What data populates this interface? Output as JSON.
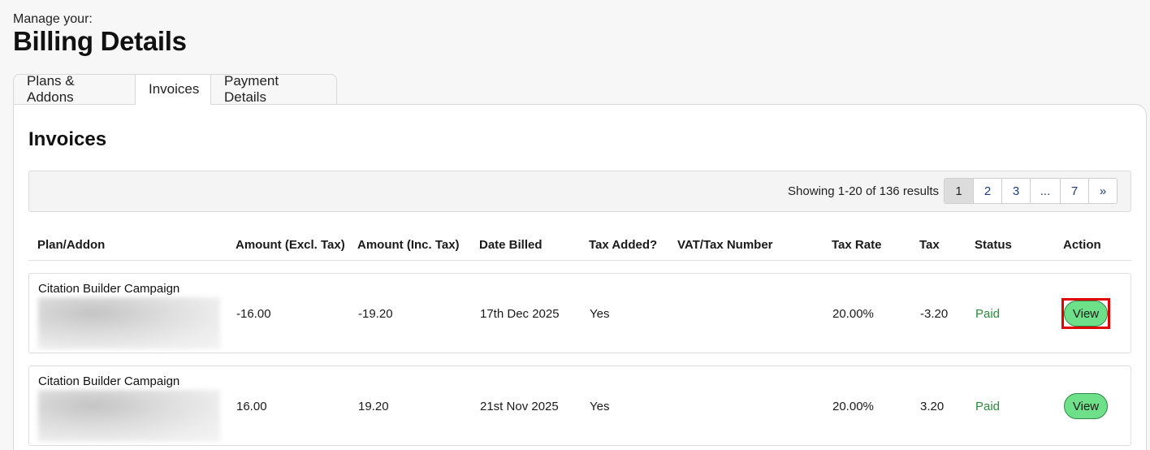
{
  "header": {
    "eyebrow": "Manage your:",
    "title": "Billing Details"
  },
  "tabs": [
    {
      "label": "Plans & Addons",
      "active": false
    },
    {
      "label": "Invoices",
      "active": true
    },
    {
      "label": "Payment Details",
      "active": false
    }
  ],
  "panel": {
    "title": "Invoices",
    "results_text": "Showing 1-20 of 136 results",
    "pagination": [
      "1",
      "2",
      "3",
      "...",
      "7",
      "»"
    ],
    "current_page": "1"
  },
  "table": {
    "headers": [
      "Plan/Addon",
      "Amount (Excl. Tax)",
      "Amount (Inc. Tax)",
      "Date Billed",
      "Tax Added?",
      "VAT/Tax Number",
      "Tax Rate",
      "Tax",
      "Status",
      "Action"
    ],
    "rows": [
      {
        "plan": "Citation Builder Campaign",
        "amount_excl": "-16.00",
        "amount_inc": "-19.20",
        "date": "17th Dec 2025",
        "tax_added": "Yes",
        "vat_number": "",
        "tax_rate": "20.00%",
        "tax": "-3.20",
        "status": "Paid",
        "action": "View",
        "highlighted": true
      },
      {
        "plan": "Citation Builder Campaign",
        "amount_excl": "16.00",
        "amount_inc": "19.20",
        "date": "21st Nov 2025",
        "tax_added": "Yes",
        "vat_number": "",
        "tax_rate": "20.00%",
        "tax": "3.20",
        "status": "Paid",
        "action": "View",
        "highlighted": false
      }
    ]
  },
  "colors": {
    "accent_green": "#6fe08a",
    "paid_text": "#2b8a3e",
    "highlight_red": "#e00000",
    "pager_link": "#1f3a78"
  }
}
